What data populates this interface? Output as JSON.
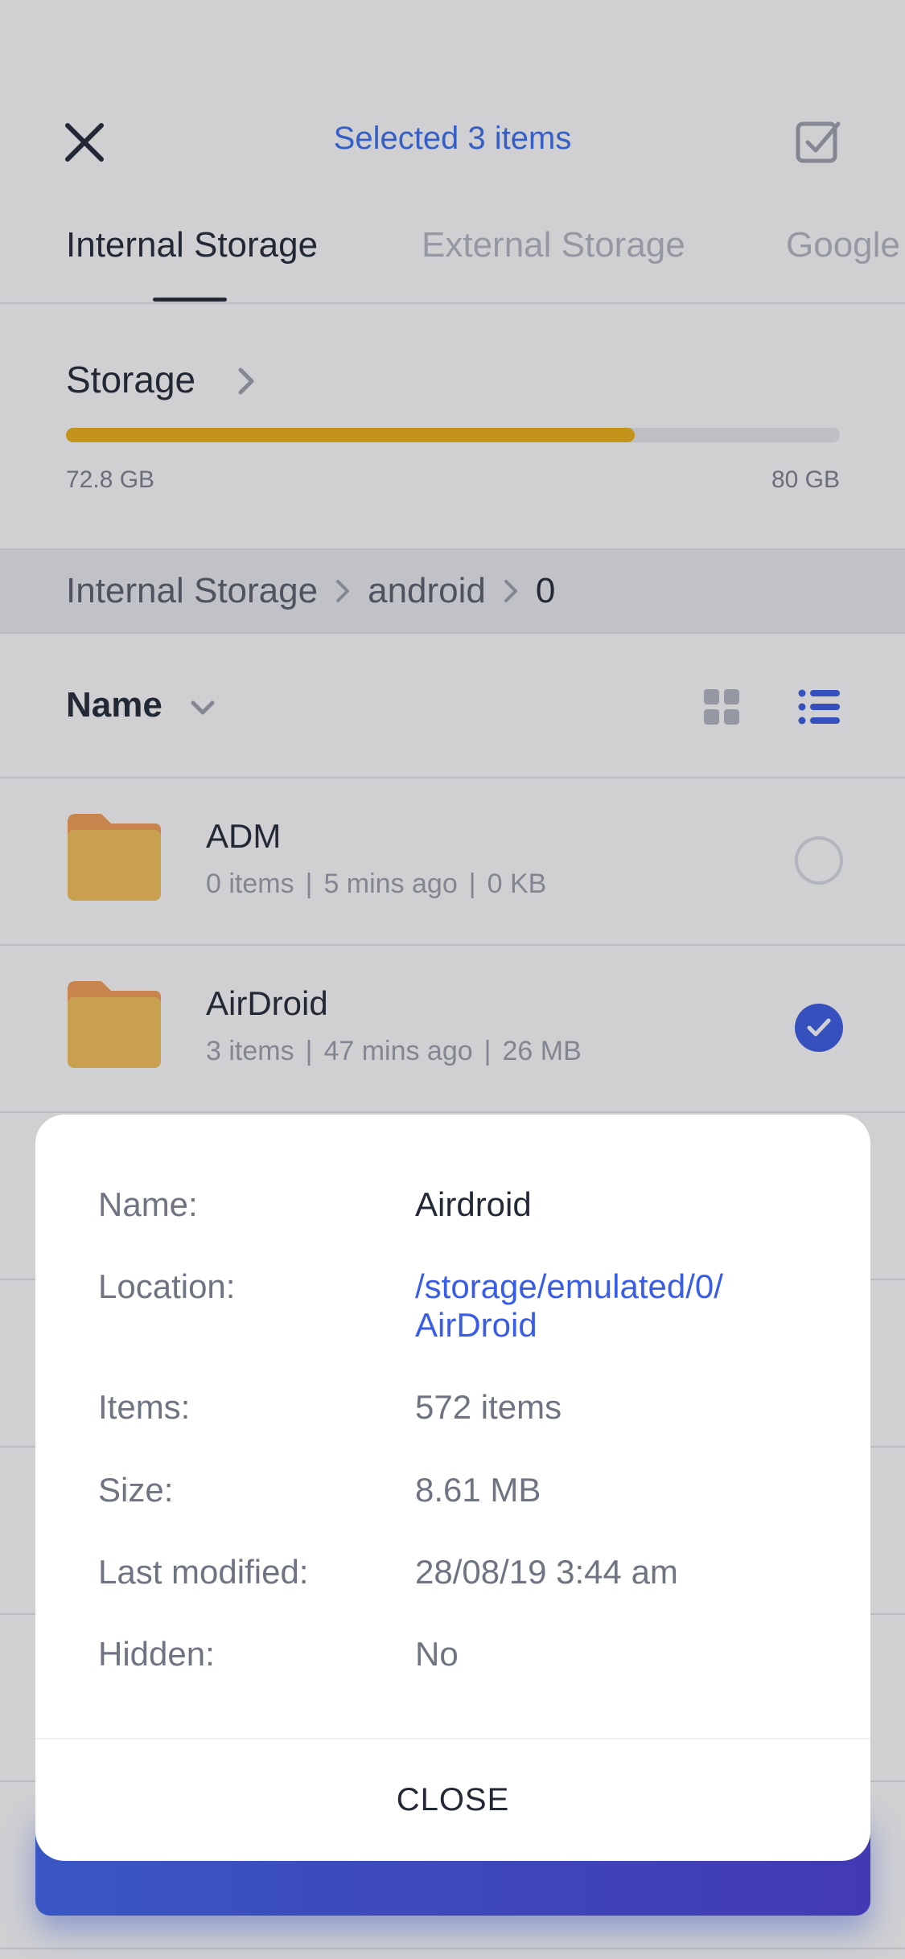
{
  "header": {
    "title": "Selected 3 items"
  },
  "tabs": [
    {
      "label": "Internal Storage",
      "active": true
    },
    {
      "label": "External Storage",
      "active": false
    },
    {
      "label": "Google Drive",
      "active": false
    }
  ],
  "storage": {
    "title": "Storage",
    "used": "72.8 GB",
    "total": "80 GB",
    "used_fraction": 0.735,
    "bar_color": "#f0b114"
  },
  "breadcrumb": [
    "Internal Storage",
    "android",
    "0"
  ],
  "sort": {
    "label": "Name"
  },
  "files": [
    {
      "name": "ADM",
      "items": "0 items",
      "modified": "5 mins ago",
      "size": "0 KB",
      "selected": false
    },
    {
      "name": "AirDroid",
      "items": "3 items",
      "modified": "47 mins ago",
      "size": "26 MB",
      "selected": true
    }
  ],
  "details": {
    "name_label": "Name:",
    "name_value": "Airdroid",
    "location_label": "Location:",
    "location_value_line1": "/storage/emulated/0/",
    "location_value_line2": "AirDroid",
    "items_label": "Items:",
    "items_value": "572 items",
    "size_label": "Size:",
    "size_value": "8.61 MB",
    "modified_label": "Last modified:",
    "modified_value": "28/08/19 3:44 am",
    "hidden_label": "Hidden:",
    "hidden_value": "No",
    "close_label": "CLOSE"
  },
  "colors": {
    "accent": "#3a5de6",
    "title_blue": "#3a6ff0",
    "folder": "#f7c259",
    "folder_tab": "#f59e55"
  }
}
